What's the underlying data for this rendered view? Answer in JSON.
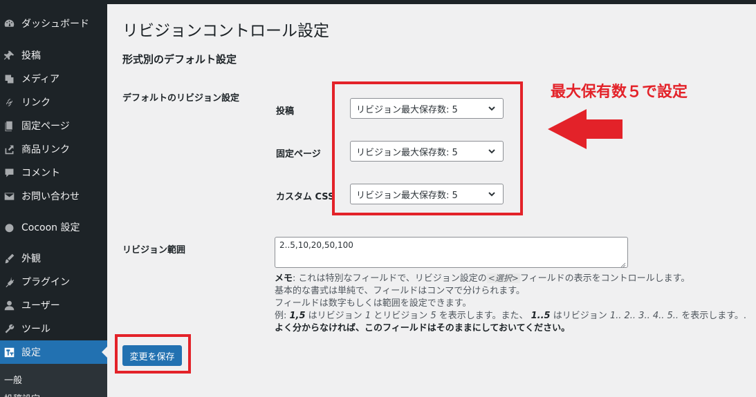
{
  "sidebar": {
    "items": [
      {
        "label": "ダッシュボード",
        "icon": "dashboard-icon"
      },
      {
        "label": "投稿",
        "icon": "pin-icon"
      },
      {
        "label": "メディア",
        "icon": "media-icon"
      },
      {
        "label": "リンク",
        "icon": "link-icon"
      },
      {
        "label": "固定ページ",
        "icon": "page-icon"
      },
      {
        "label": "商品リンク",
        "icon": "share-icon"
      },
      {
        "label": "コメント",
        "icon": "comment-icon"
      },
      {
        "label": "お問い合わせ",
        "icon": "mail-icon"
      },
      {
        "label": "Cocoon 設定",
        "icon": "circle-icon"
      },
      {
        "label": "外観",
        "icon": "brush-icon"
      },
      {
        "label": "プラグイン",
        "icon": "plugin-icon"
      },
      {
        "label": "ユーザー",
        "icon": "user-icon"
      },
      {
        "label": "ツール",
        "icon": "wrench-icon"
      },
      {
        "label": "設定",
        "icon": "settings-icon"
      }
    ],
    "active_index": 13,
    "submenu": [
      {
        "label": "一般"
      },
      {
        "label": "投稿設定"
      }
    ]
  },
  "page": {
    "title": "リビジョンコントロール設定",
    "section_title": "形式別のデフォルト設定",
    "default_label": "デフォルトのリビジョン設定",
    "rows": [
      {
        "label": "投稿",
        "value": "リビジョン最大保存数: 5"
      },
      {
        "label": "固定ページ",
        "value": "リビジョン最大保存数: 5"
      },
      {
        "label": "カスタム CSS",
        "value": "リビジョン最大保存数: 5"
      }
    ],
    "range_label": "リビジョン範囲",
    "range_value": "2..5,10,20,50,100",
    "description": {
      "line1_bold": "メモ",
      "line1_a": ": これは特別なフィールドで、リビジョン設定の",
      "line1_code": "<選択>",
      "line1_b": "フィールドの表示をコントロールします。",
      "line2": "基本的な書式は単純で、フィールドはコンマで分けられます。",
      "line3": "フィールドは数字もしくは範囲を設定できます。",
      "line4_a": "例: ",
      "line4_b1": "1,5",
      "line4_c": " はリビジョン ",
      "line4_d": "1",
      "line4_e": " とリビジョン ",
      "line4_f": "5",
      "line4_g": " を表示します。また、 ",
      "line4_h": "1..5",
      "line4_i": " はリビジョン ",
      "line4_j": "1.. 2.. 3.. 4.. 5..",
      "line4_k": " を表示します。.",
      "line5": "よく分からなければ、このフィールドはそのままにしておいてください。"
    },
    "save_label": "変更を保存"
  },
  "annotation": {
    "text": "最大保有数５で設定",
    "color": "#e32229"
  }
}
